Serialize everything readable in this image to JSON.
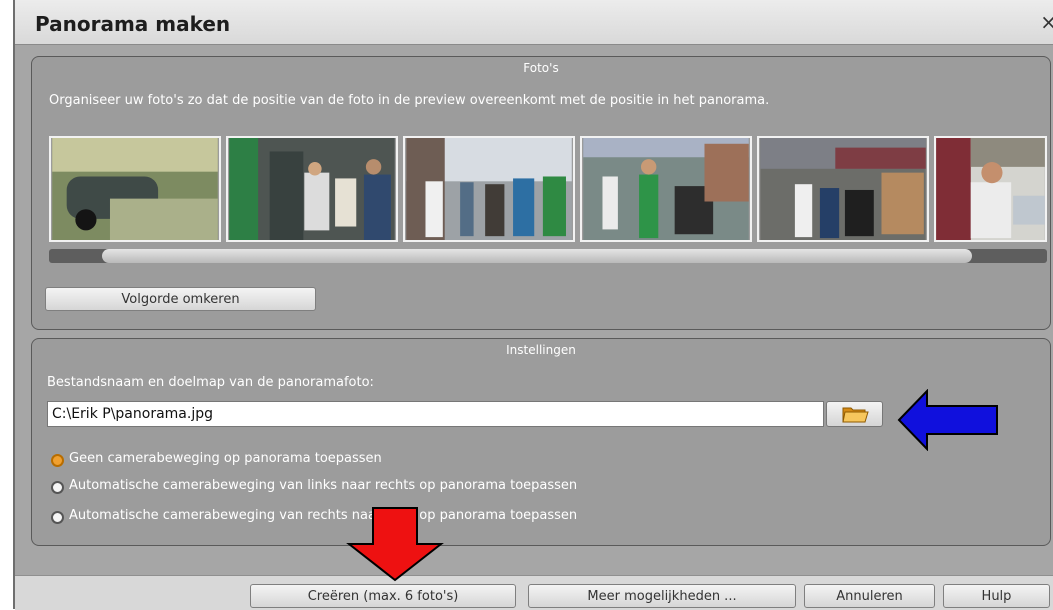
{
  "dialog": {
    "title": "Panorama maken",
    "close_glyph": "×"
  },
  "photos_section": {
    "title": "Foto's",
    "instruction": "Organiseer uw foto's zo dat de positie van de foto in de preview overeenkomt met de positie in het panorama.",
    "reverse_button": "Volgorde omkeren"
  },
  "settings_section": {
    "title": "Instellingen",
    "filename_label": "Bestandsnaam en doelmap van de panoramafoto:",
    "filename_value": "C:\\Erik P\\panorama.jpg",
    "options": [
      {
        "label": "Geen camerabeweging op panorama toepassen",
        "selected": true
      },
      {
        "label": "Automatische camerabeweging van links naar rechts op panorama toepassen",
        "selected": false
      },
      {
        "label": "Automatische camerabeweging van rechts naar links op panorama toepassen",
        "selected": false
      }
    ]
  },
  "buttons": {
    "create": "Creëren (max. 6 foto's)",
    "more": "Meer mogelijkheden ...",
    "cancel": "Annuleren",
    "help": "Hulp"
  },
  "annotations": {
    "blue_arrow_color": "#1010dd",
    "red_arrow_color": "#ee1111"
  }
}
